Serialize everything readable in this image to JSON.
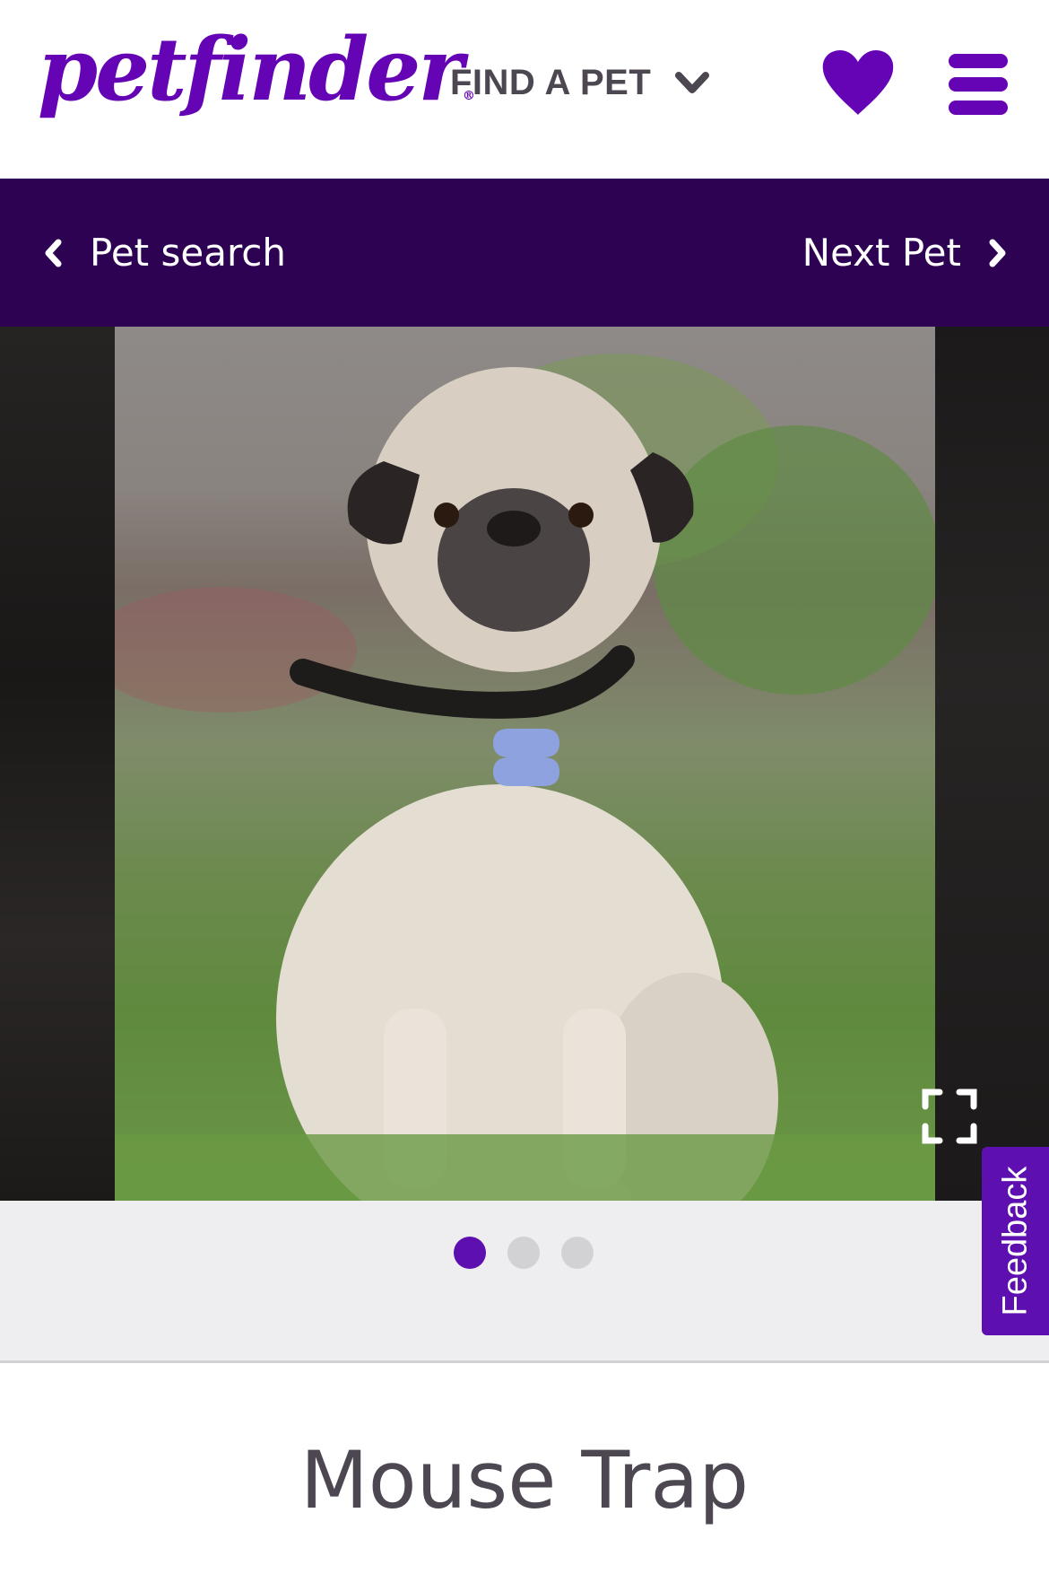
{
  "header": {
    "logo_text": "petfinder",
    "logo_registered": "®",
    "find_a_pet_label": "FIND A PET",
    "favorites_icon": "heart-icon",
    "menu_icon": "hamburger-menu-icon"
  },
  "subnav": {
    "back_label": "Pet search",
    "next_label": "Next Pet"
  },
  "gallery": {
    "photo_alt": "Pug sitting on grass wearing a black collar with a blue bone-shaped tag",
    "expand_icon": "fullscreen-expand-icon",
    "total_slides": 3,
    "active_slide": 1
  },
  "feedback": {
    "label": "Feedback"
  },
  "pet": {
    "name": "Mouse Trap"
  },
  "colors": {
    "brand_purple": "#6504b5",
    "nav_dark_purple": "#2d0253",
    "text_gray": "#4d4751",
    "dot_inactive": "#d2d2d5",
    "band_bg": "#eeeef1"
  }
}
